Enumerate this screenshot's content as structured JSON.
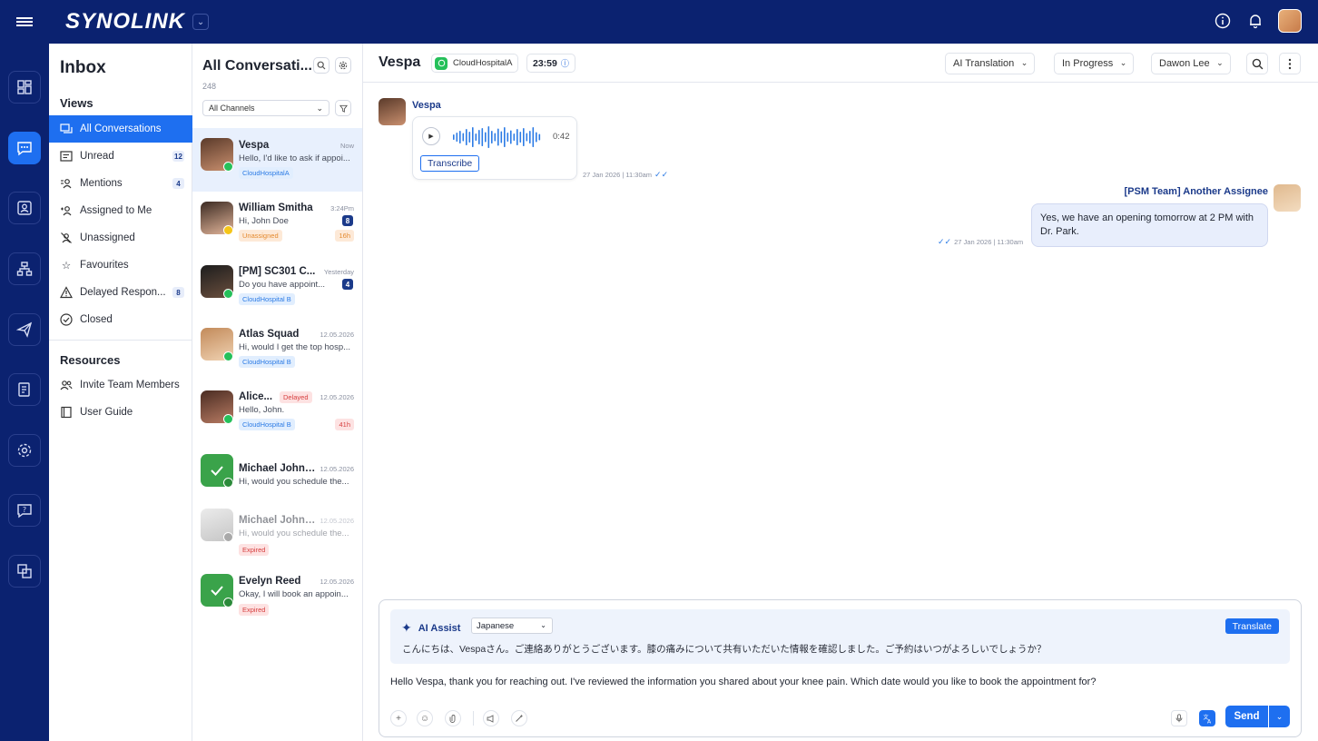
{
  "brand": {
    "name": "SYNOLINK"
  },
  "sidebar": {
    "title": "Inbox",
    "views_heading": "Views",
    "views": [
      {
        "label": "All Conversations",
        "badge": ""
      },
      {
        "label": "Unread",
        "badge": "12"
      },
      {
        "label": "Mentions",
        "badge": "4"
      },
      {
        "label": "Assigned to Me",
        "badge": ""
      },
      {
        "label": "Unassigned",
        "badge": ""
      },
      {
        "label": "Favourites",
        "badge": ""
      },
      {
        "label": "Delayed Respon...",
        "badge": "8"
      },
      {
        "label": "Closed",
        "badge": ""
      }
    ],
    "resources_heading": "Resources",
    "resources": [
      {
        "label": "Invite Team Members"
      },
      {
        "label": "User Guide"
      }
    ]
  },
  "conversations": {
    "title": "All Conversati...",
    "count": "248",
    "channel_filter": "All Channels",
    "items": [
      {
        "name": "Vespa",
        "time": "Now",
        "preview": "Hello, I'd like to ask if appoi...",
        "tag": "CloudHospitalA",
        "badge": "",
        "sla": "",
        "delayed": ""
      },
      {
        "name": "William Smitha",
        "time": "3:24Pm",
        "preview": "Hi, John Doe",
        "tag": "Unassigned",
        "badge": "8",
        "sla": "16h",
        "delayed": ""
      },
      {
        "name": "[PM] SC301 C...",
        "time": "Yesterday",
        "preview": "Do you have appoint...",
        "tag": "CloudHospital B",
        "badge": "4",
        "sla": "",
        "delayed": ""
      },
      {
        "name": "Atlas Squad",
        "time": "12.05.2026",
        "preview": "Hi, would I get the top hosp...",
        "tag": "CloudHospital B",
        "badge": "",
        "sla": "",
        "delayed": ""
      },
      {
        "name": "Alice...",
        "time": "12.05.2026",
        "preview": "Hello, John.",
        "tag": "CloudHospital B",
        "badge": "",
        "sla": "41h",
        "delayed": "Delayed"
      },
      {
        "name": "Michael Johns...",
        "time": "12.05.2026",
        "preview": "Hi, would you schedule the...",
        "tag": "",
        "badge": "",
        "sla": "",
        "delayed": ""
      },
      {
        "name": "Michael Johns...",
        "time": "12.05.2026",
        "preview": "Hi, would you schedule the...",
        "tag": "Expired",
        "badge": "",
        "sla": "",
        "delayed": ""
      },
      {
        "name": "Evelyn Reed",
        "time": "12.05.2026",
        "preview": "Okay, I will book an appoin...",
        "tag": "Expired",
        "badge": "",
        "sla": "",
        "delayed": ""
      }
    ]
  },
  "chat": {
    "contact_name": "Vespa",
    "channel": "CloudHospitalA",
    "timer": "23:59",
    "translation_mode": "AI Translation",
    "status": "In Progress",
    "assignee": "Dawon Lee",
    "messages": {
      "incoming_sender": "Vespa",
      "voice_duration": "0:42",
      "transcribe_label": "Transcribe",
      "incoming_time": "27 Jan 2026 | 11:30am",
      "outgoing_sender": "[PSM Team] Another Assignee",
      "outgoing_text": "Yes, we have an opening tomorrow at 2 PM with Dr. Park.",
      "outgoing_time": "27 Jan 2026 | 11:30am"
    },
    "composer": {
      "ai_assist_label": "AI Assist",
      "language": "Japanese",
      "translate_label": "Translate",
      "translated_text": "こんにちは、Vespaさん。ご連絡ありがとうございます。膝の痛みについて共有いただいた情報を確認しました。ご予約はいつがよろしいでしょうか？",
      "draft_text": "Hello Vespa, thank you for reaching out. I've reviewed the information you shared about your knee pain. Which date would you like to book the appointment for?",
      "send_label": "Send"
    }
  },
  "colors": {
    "nav_bg": "#0b2270",
    "accent": "#1e6ff0",
    "whatsapp": "#25c05a"
  }
}
